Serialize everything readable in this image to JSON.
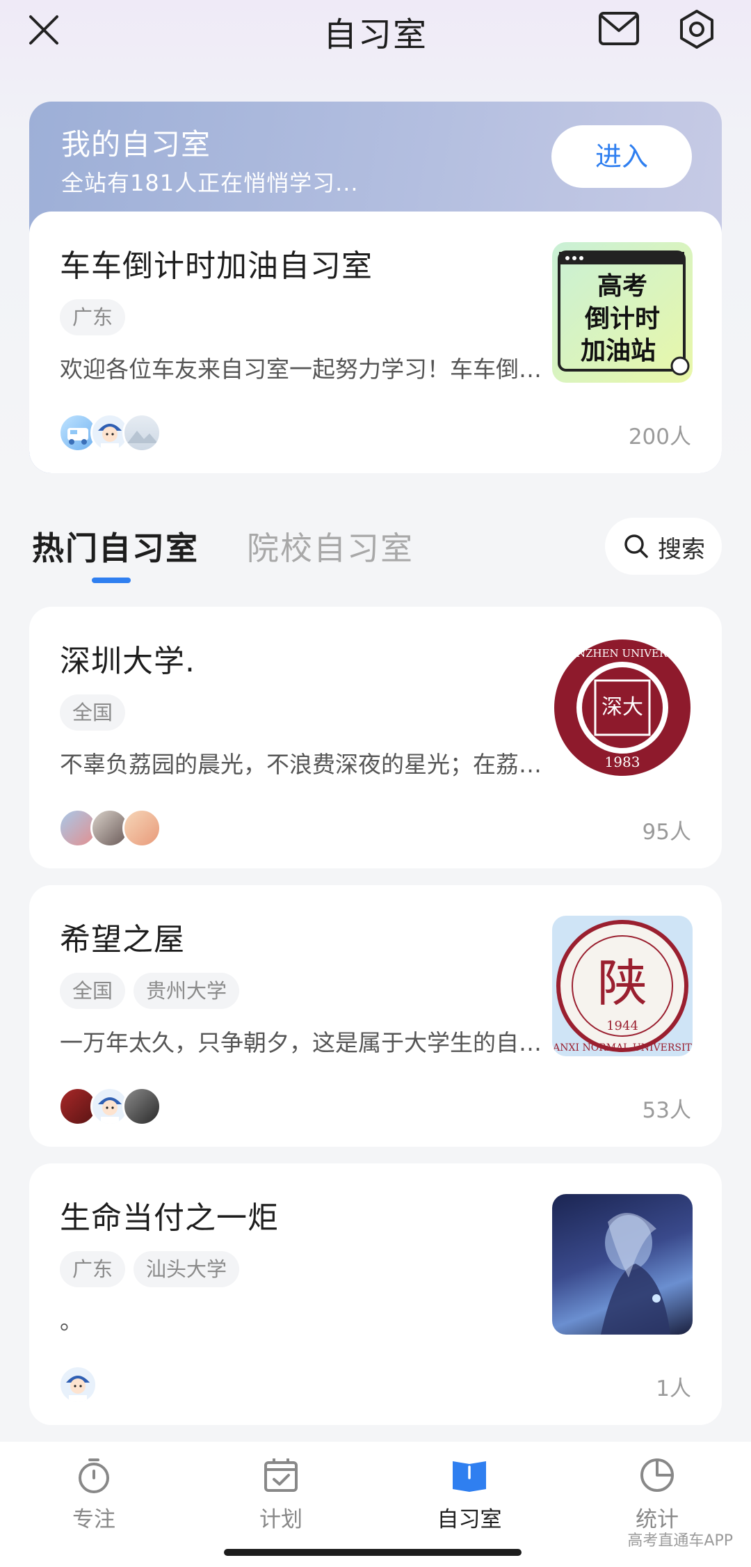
{
  "header": {
    "title": "自习室",
    "close_icon": "close-icon",
    "mail_icon": "mail-icon",
    "settings_icon": "settings-icon"
  },
  "my_room": {
    "title": "我的自习室",
    "subtitle": "全站有181人正在悄悄学习...",
    "enter_label": "进入",
    "card": {
      "title": "车车倒计时加油自习室",
      "tags": [
        "广东"
      ],
      "description": "欢迎各位车友来自习室一起努力学习！车车倒计时加油站",
      "count": "200人",
      "thumb_text": [
        "高考",
        "倒计时",
        "加油站"
      ]
    }
  },
  "tabs": {
    "hot": "热门自习室",
    "school": "院校自习室",
    "search_label": "搜索"
  },
  "rooms": [
    {
      "title": "深圳大学.",
      "tags": [
        "全国"
      ],
      "description": "不辜负荔园的晨光，不浪费深夜的星光；在荔园一起学习",
      "count": "95人",
      "thumb_year": "1983",
      "thumb_ring_text": "SHENZHEN UNIVERSITY"
    },
    {
      "title": "希望之屋",
      "tags": [
        "全国",
        "贵州大学"
      ],
      "description": "一万年太久，只争朝夕，这是属于大学生的自习室",
      "count": "53人",
      "thumb_year": "1944",
      "thumb_ring_text": "ANXI NORMAL UNIVERSIT"
    },
    {
      "title": "生命当付之一炬",
      "tags": [
        "广东",
        "汕头大学"
      ],
      "description": "。",
      "count": "1人"
    }
  ],
  "bottom_nav": [
    {
      "label": "专注",
      "icon": "stopwatch-icon"
    },
    {
      "label": "计划",
      "icon": "calendar-check-icon"
    },
    {
      "label": "自习室",
      "icon": "book-icon"
    },
    {
      "label": "统计",
      "icon": "pie-chart-icon"
    }
  ],
  "watermark": "高考直通车APP",
  "colors": {
    "accent": "#2f7ff0",
    "university_red": "#8e1a2c"
  }
}
